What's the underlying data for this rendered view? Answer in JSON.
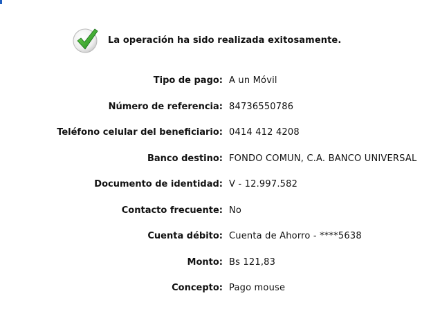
{
  "status": {
    "message": "La operación ha sido realizada exitosamente.",
    "icon": "checkmark-icon",
    "icon_color": "#2e9e2e"
  },
  "details": [
    {
      "label": "Tipo de pago:",
      "value": "A un Móvil"
    },
    {
      "label": "Número de referencia:",
      "value": "84736550786"
    },
    {
      "label": "Teléfono celular del beneficiario:",
      "value": "0414 412 4208"
    },
    {
      "label": "Banco destino:",
      "value": "FONDO COMUN, C.A. BANCO UNIVERSAL"
    },
    {
      "label": "Documento de identidad:",
      "value": "V - 12.997.582"
    },
    {
      "label": "Contacto frecuente:",
      "value": "No"
    },
    {
      "label": "Cuenta débito:",
      "value": "Cuenta de Ahorro - ****5638"
    },
    {
      "label": "Monto:",
      "value": "Bs 121,83"
    },
    {
      "label": "Concepto:",
      "value": "Pago mouse"
    }
  ]
}
